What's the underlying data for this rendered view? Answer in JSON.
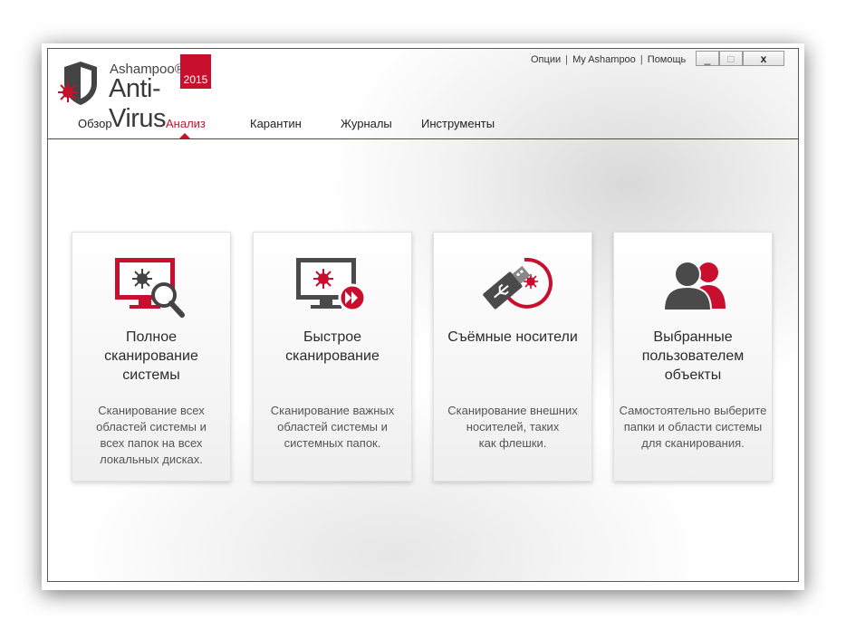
{
  "app": {
    "brand": "Ashampoo®",
    "product": "Anti-Virus",
    "year": "2015"
  },
  "top_links": {
    "options": "Опции",
    "my_ashampoo": "My Ashampoo",
    "help": "Помощь",
    "separator": "|"
  },
  "window_controls": {
    "minimize": "_",
    "maximize": "□",
    "close": "x"
  },
  "tabs": [
    {
      "label": "Обзор",
      "active": false
    },
    {
      "label": "Анализ",
      "active": true
    },
    {
      "label": "Карантин",
      "active": false
    },
    {
      "label": "Журналы",
      "active": false
    },
    {
      "label": "Инструменты",
      "active": false
    }
  ],
  "cards": [
    {
      "icon": "monitor-search-icon",
      "title": [
        "Полное",
        "сканирование",
        "системы"
      ],
      "description": [
        "Сканирование всех",
        "областей системы и",
        "всех папок на всех",
        "локальных дисках."
      ]
    },
    {
      "icon": "monitor-fast-forward-icon",
      "title": [
        "Быстрое",
        "сканирование"
      ],
      "description": [
        "Сканирование важных",
        "областей системы и",
        "системных папок."
      ]
    },
    {
      "icon": "usb-drive-icon",
      "title": [
        "Съёмные носители"
      ],
      "description": [
        "Сканирование внешних",
        "носителей, таких",
        "как флешки."
      ]
    },
    {
      "icon": "users-icon",
      "title": [
        "Выбранные",
        "пользователем",
        "объекты"
      ],
      "description": [
        "Самостоятельно выберите",
        "папки и области системы",
        "для сканирования."
      ]
    }
  ],
  "colors": {
    "accent": "#c8102e",
    "dark_icon": "#4a4a4a"
  }
}
